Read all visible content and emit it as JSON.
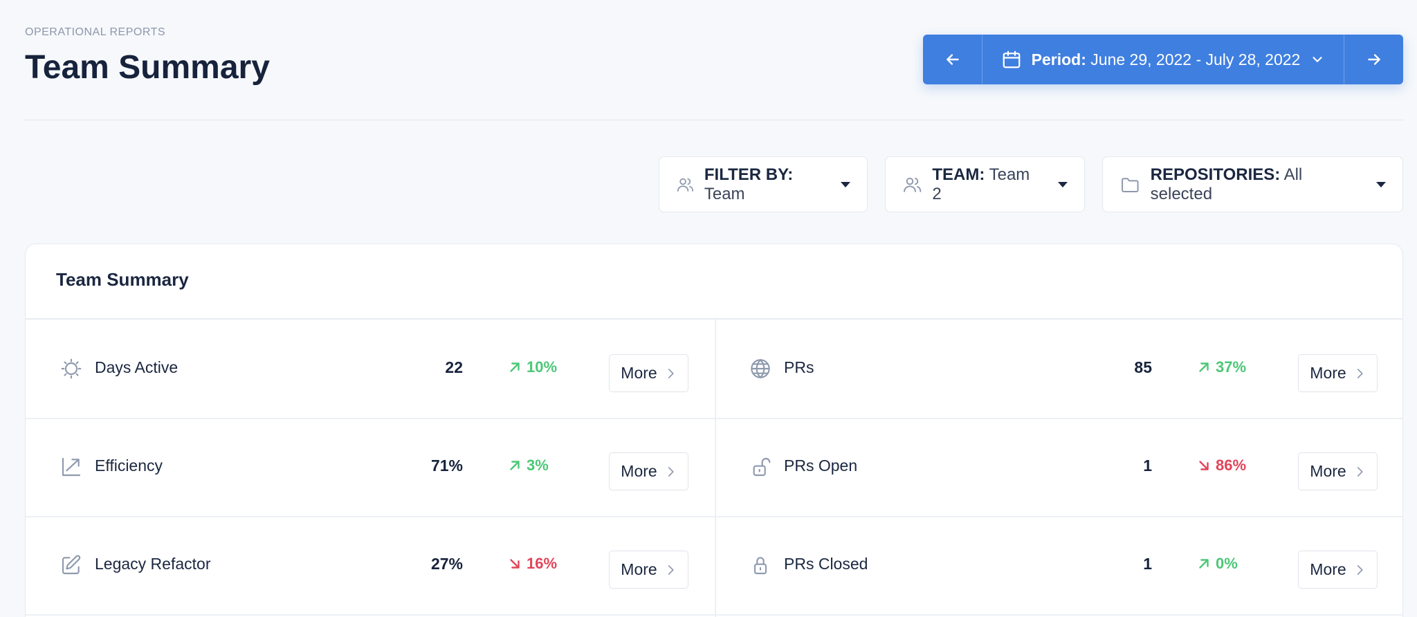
{
  "header": {
    "eyebrow": "OPERATIONAL REPORTS",
    "title": "Team Summary"
  },
  "period": {
    "label": "Period:",
    "value": "June 29, 2022 - July 28, 2022"
  },
  "filters": {
    "filter_by": {
      "label": "FILTER BY:",
      "value": "Team"
    },
    "team": {
      "label": "TEAM:",
      "value": "Team 2"
    },
    "repositories": {
      "label": "REPOSITORIES:",
      "value": "All selected"
    }
  },
  "card": {
    "title": "Team Summary",
    "more_label": "More",
    "metrics": [
      {
        "label": "Days Active",
        "value": "22",
        "delta": "10%",
        "trend": "up",
        "icon": "sun-icon"
      },
      {
        "label": "PRs",
        "value": "85",
        "delta": "37%",
        "trend": "up",
        "icon": "globe-icon"
      },
      {
        "label": "Efficiency",
        "value": "71%",
        "delta": "3%",
        "trend": "up",
        "icon": "trend-up-icon"
      },
      {
        "label": "PRs Open",
        "value": "1",
        "delta": "86%",
        "trend": "down",
        "icon": "unlock-icon"
      },
      {
        "label": "Legacy Refactor",
        "value": "27%",
        "delta": "16%",
        "trend": "down",
        "icon": "edit-icon"
      },
      {
        "label": "PRs Closed",
        "value": "1",
        "delta": "0%",
        "trend": "up",
        "icon": "lock-icon"
      }
    ]
  },
  "colors": {
    "accent": "#3f7fe0",
    "up": "#4cc776",
    "down": "#e0445a"
  }
}
